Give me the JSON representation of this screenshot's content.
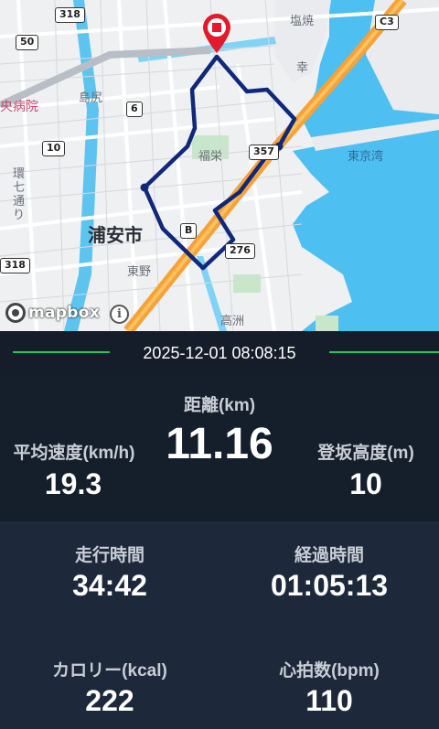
{
  "map": {
    "labels": {
      "shiohama": "塩焼",
      "saiwai": "幸",
      "shimajiri": "島尻",
      "hospital": "央病院",
      "fukuei": "福栄",
      "tokyo_bay": "東京湾",
      "urayasu": "浦安市",
      "kannana": "環七通り",
      "higashino": "東野",
      "takasu": "高洲"
    },
    "shields": {
      "r318_top": "318",
      "r50": "50",
      "r6": "6",
      "r10": "10",
      "r357": "357",
      "rB": "B",
      "r276": "276",
      "r318_bottom": "318",
      "c3": "C3"
    },
    "attribution": "mapbox",
    "info_icon": "info-icon",
    "end_marker_icon": "map-pin-icon",
    "route_color": "#10287a"
  },
  "date": "2025-12-01 08:08:15",
  "stats": {
    "distance": {
      "label": "距離(km)",
      "value": "11.16"
    },
    "avg_speed": {
      "label": "平均速度(km/h)",
      "value": "19.3"
    },
    "climb": {
      "label": "登坂高度(m)",
      "value": "10"
    },
    "moving_time": {
      "label": "走行時間",
      "value": "34:42"
    },
    "elapsed_time": {
      "label": "経過時間",
      "value": "01:05:13"
    },
    "calories": {
      "label": "カロリー(kcal)",
      "value": "222"
    },
    "heart_rate": {
      "label": "心拍数(bpm)",
      "value": "110"
    }
  },
  "colors": {
    "accent_line": "#22c55e",
    "background": "#1a2433"
  }
}
